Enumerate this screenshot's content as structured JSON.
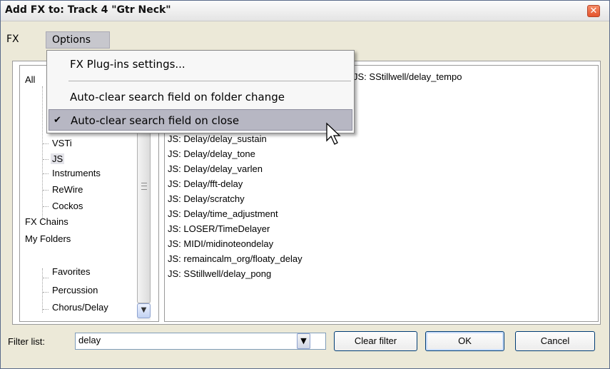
{
  "window": {
    "title": "Add FX to: Track 4 \"Gtr Neck\"",
    "close_glyph": "✕"
  },
  "menubar": {
    "fx": "FX",
    "options": "Options"
  },
  "options_menu": {
    "items": [
      "FX Plug-ins settings...",
      "Auto-clear search field on folder change",
      "Auto-clear search field on close"
    ],
    "checked_index": 2,
    "check_glyph": "✔"
  },
  "tree": {
    "items": [
      "All",
      "VSTi",
      "JS",
      "Instruments",
      "ReWire",
      "Cockos",
      "FX Chains",
      "My Folders",
      "Favorites",
      "Percussion",
      "Chorus/Delay"
    ],
    "scroll_down_glyph": "▼"
  },
  "list": {
    "header_item": "JS: SStillwell/delay_tempo",
    "items": [
      "JS: Delay/delay_sustain",
      "JS: Delay/delay_tone",
      "JS: Delay/delay_varlen",
      "JS: Delay/fft-delay",
      "JS: Delay/scratchy",
      "JS: Delay/time_adjustment",
      "JS: LOSER/TimeDelayer",
      "JS: MIDI/midinoteondelay",
      "JS: remaincalm_org/floaty_delay",
      "JS: SStillwell/delay_pong"
    ]
  },
  "filter": {
    "label": "Filter list:",
    "value": "delay",
    "drop_glyph": "▼"
  },
  "buttons": {
    "clear": "Clear filter",
    "ok": "OK",
    "cancel": "Cancel"
  },
  "colors": {
    "accent": "#e4532c",
    "selection": "#b7b7c3"
  }
}
